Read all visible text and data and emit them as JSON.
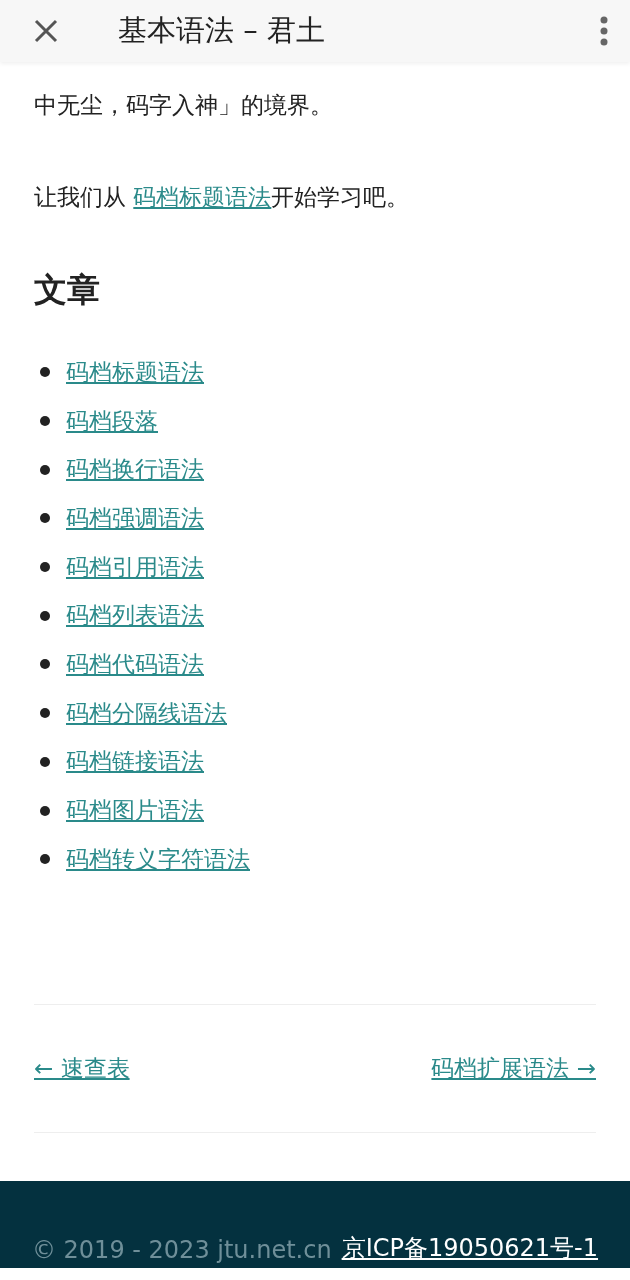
{
  "header": {
    "title": "基本语法 – 君土"
  },
  "intro_tail": "中无尘，码字入神」的境界。",
  "start": {
    "before": "让我们从 ",
    "link": "码档标题语法",
    "after": "开始学习吧。"
  },
  "section_heading": "文章",
  "articles": [
    "码档标题语法",
    "码档段落",
    "码档换行语法",
    "码档强调语法",
    "码档引用语法",
    "码档列表语法",
    "码档代码语法",
    "码档分隔线语法",
    "码档链接语法",
    "码档图片语法",
    "码档转义字符语法"
  ],
  "nav": {
    "previous": "← 速查表",
    "next": "码档扩展语法 →"
  },
  "footer": {
    "copyright": "© 2019 - 2023 jtu.net.cn",
    "icp": "京ICP备19050621号-1"
  }
}
